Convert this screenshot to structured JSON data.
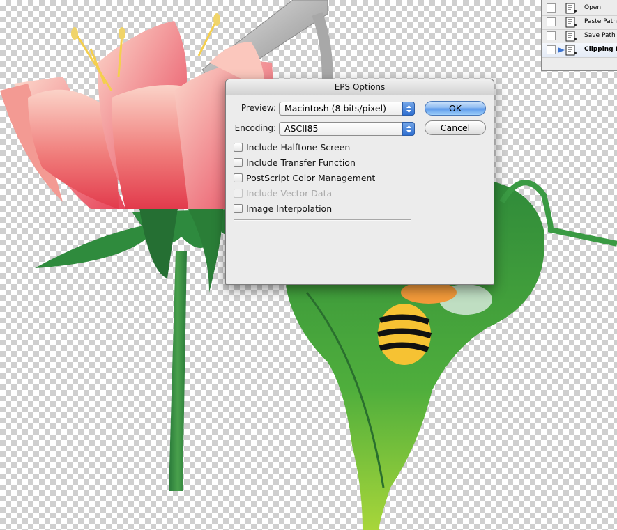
{
  "dialog": {
    "title": "EPS Options",
    "preview_label": "Preview:",
    "preview_value": "Macintosh  (8 bits/pixel)",
    "encoding_label": "Encoding:",
    "encoding_value": "ASCII85",
    "ok_label": "OK",
    "cancel_label": "Cancel",
    "options": [
      {
        "label": "Include Halftone Screen",
        "checked": false,
        "enabled": true
      },
      {
        "label": "Include Transfer Function",
        "checked": false,
        "enabled": true
      },
      {
        "label": "PostScript Color Management",
        "checked": false,
        "enabled": true
      },
      {
        "label": "Include Vector Data",
        "checked": false,
        "enabled": false
      },
      {
        "label": "Image Interpolation",
        "checked": false,
        "enabled": true
      }
    ]
  },
  "actions_panel": {
    "items": [
      {
        "label": "Open",
        "selected": false
      },
      {
        "label": "Paste Path",
        "selected": false
      },
      {
        "label": "Save Path",
        "selected": false
      },
      {
        "label": "Clipping P",
        "selected": true
      }
    ]
  },
  "colors": {
    "default_button": "#5d9aeb",
    "popup_arrow": "#2e6ed0",
    "petal": "#e8505a",
    "leaf": "#3e9a3c"
  }
}
